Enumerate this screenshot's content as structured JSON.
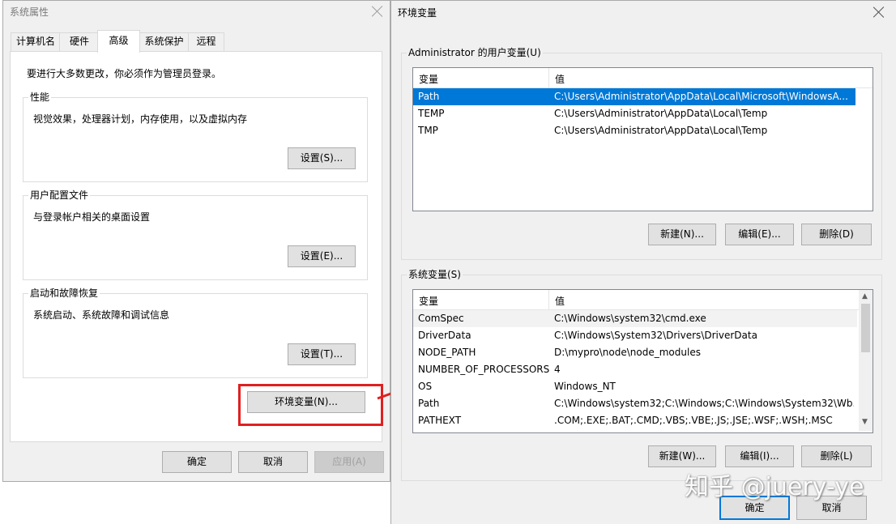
{
  "sysprops": {
    "title": "系统属性",
    "tabs": [
      "计算机名",
      "硬件",
      "高级",
      "系统保护",
      "远程"
    ],
    "notice": "要进行大多数更改，你必须作为管理员登录。",
    "performance": {
      "label": "性能",
      "desc": "视觉效果，处理器计划，内存使用，以及虚拟内存",
      "button": "设置(S)..."
    },
    "profiles": {
      "label": "用户配置文件",
      "desc": "与登录帐户相关的桌面设置",
      "button": "设置(E)..."
    },
    "startup": {
      "label": "启动和故障恢复",
      "desc": "系统启动、系统故障和调试信息",
      "button": "设置(T)..."
    },
    "env_button": "环境变量(N)...",
    "ok": "确定",
    "cancel": "取消",
    "apply": "应用(A)"
  },
  "envvars": {
    "title": "环境变量",
    "user_group": "Administrator 的用户变量(U)",
    "col_var": "变量",
    "col_val": "值",
    "user_rows": [
      {
        "name": "Path",
        "value": "C:\\Users\\Administrator\\AppData\\Local\\Microsoft\\WindowsA..."
      },
      {
        "name": "TEMP",
        "value": "C:\\Users\\Administrator\\AppData\\Local\\Temp"
      },
      {
        "name": "TMP",
        "value": "C:\\Users\\Administrator\\AppData\\Local\\Temp"
      }
    ],
    "user_new": "新建(N)...",
    "user_edit": "编辑(E)...",
    "user_delete": "删除(D)",
    "sys_group": "系统变量(S)",
    "sys_rows": [
      {
        "name": "ComSpec",
        "value": "C:\\Windows\\system32\\cmd.exe"
      },
      {
        "name": "DriverData",
        "value": "C:\\Windows\\System32\\Drivers\\DriverData"
      },
      {
        "name": "NODE_PATH",
        "value": "D:\\mypro\\node\\node_modules"
      },
      {
        "name": "NUMBER_OF_PROCESSORS",
        "value": "4"
      },
      {
        "name": "OS",
        "value": "Windows_NT"
      },
      {
        "name": "Path",
        "value": "C:\\Windows\\system32;C:\\Windows;C:\\Windows\\System32\\Wb..."
      },
      {
        "name": "PATHEXT",
        "value": ".COM;.EXE;.BAT;.CMD;.VBS;.VBE;.JS;.JSE;.WSF;.WSH;.MSC"
      }
    ],
    "sys_new": "新建(W)...",
    "sys_edit": "编辑(I)...",
    "sys_delete": "删除(L)",
    "ok": "确定",
    "cancel": "取消"
  },
  "watermark": "知乎 @juery-ye",
  "colors": {
    "selection": "#0078d7",
    "highlight": "#e02020",
    "window": "#f0f0f0"
  },
  "icons": [
    "close-icon",
    "scroll-up-icon",
    "scroll-down-icon",
    "arrow-icon"
  ]
}
